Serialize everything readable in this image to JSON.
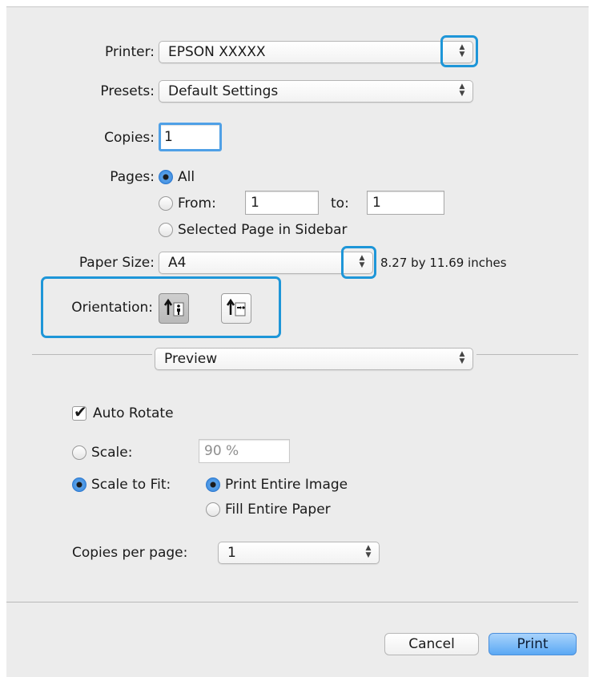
{
  "printer": {
    "label": "Printer:",
    "value": "EPSON XXXXX"
  },
  "presets": {
    "label": "Presets:",
    "value": "Default Settings"
  },
  "copies": {
    "label": "Copies:",
    "value": "1"
  },
  "pages": {
    "label": "Pages:",
    "all": "All",
    "from_label": "From:",
    "from_value": "1",
    "to_label": "to:",
    "to_value": "1",
    "selected_label": "Selected Page in Sidebar",
    "selected_option": "All"
  },
  "paper_size": {
    "label": "Paper Size:",
    "value": "A4",
    "dimensions": "8.27 by 11.69 inches"
  },
  "orientation": {
    "label": "Orientation:",
    "selected": "portrait"
  },
  "section_popup": {
    "value": "Preview"
  },
  "preview": {
    "auto_rotate": {
      "label": "Auto Rotate",
      "checked": true
    },
    "scale": {
      "label": "Scale:",
      "value": "90 %"
    },
    "scale_to_fit": {
      "label": "Scale to Fit:",
      "print_entire": "Print Entire Image",
      "fill_entire": "Fill Entire Paper",
      "selected_option": "Print Entire Image"
    },
    "copies_per_page": {
      "label": "Copies per page:",
      "value": "1"
    }
  },
  "buttons": {
    "cancel": "Cancel",
    "print": "Print"
  },
  "colors": {
    "highlight": "#1e96d8",
    "accent": "#2f80d8",
    "dialog_bg": "#ececec"
  },
  "icons": [
    "popup-arrows-icon",
    "portrait-orientation-icon",
    "landscape-orientation-icon",
    "checkmark-icon"
  ]
}
